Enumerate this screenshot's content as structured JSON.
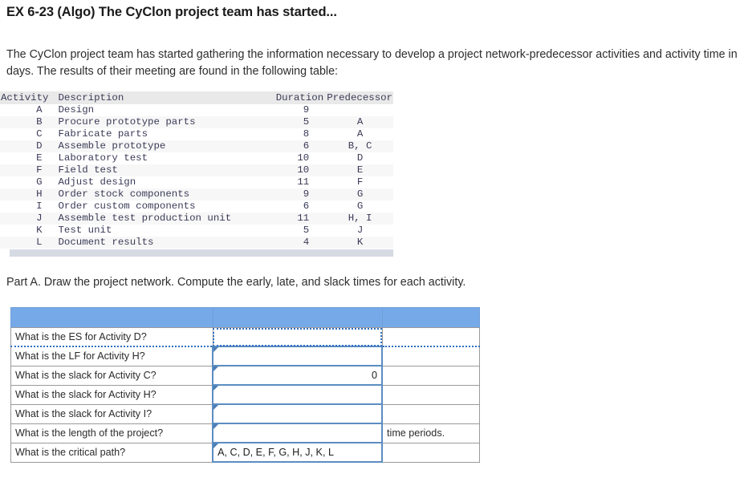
{
  "title": "EX 6-23 (Algo) The CyClon project team has started...",
  "intro": "The CyClon project team has started gathering the information necessary to develop a project network-predecessor activities and activity time in days. The results of their meeting are found in the following table:",
  "part_a": "Part A. Draw the project network. Compute the early, late, and slack times for each activity.",
  "activity_table": {
    "headers": {
      "activity": "Activity",
      "description": "Description",
      "duration": "Duration",
      "predecessor": "Predecessor"
    },
    "rows": [
      {
        "activity": "A",
        "description": "Design",
        "duration": "9",
        "predecessor": ""
      },
      {
        "activity": "B",
        "description": "Procure prototype parts",
        "duration": "5",
        "predecessor": "A"
      },
      {
        "activity": "C",
        "description": "Fabricate parts",
        "duration": "8",
        "predecessor": "A"
      },
      {
        "activity": "D",
        "description": "Assemble prototype",
        "duration": "6",
        "predecessor": "B, C"
      },
      {
        "activity": "E",
        "description": "Laboratory test",
        "duration": "10",
        "predecessor": "D"
      },
      {
        "activity": "F",
        "description": "Field test",
        "duration": "10",
        "predecessor": "E"
      },
      {
        "activity": "G",
        "description": "Adjust design",
        "duration": "11",
        "predecessor": "F"
      },
      {
        "activity": "H",
        "description": "Order stock components",
        "duration": "9",
        "predecessor": "G"
      },
      {
        "activity": "I",
        "description": "Order custom components",
        "duration": "6",
        "predecessor": "G"
      },
      {
        "activity": "J",
        "description": "Assemble test production unit",
        "duration": "11",
        "predecessor": "H, I"
      },
      {
        "activity": "K",
        "description": "Test unit",
        "duration": "5",
        "predecessor": "J"
      },
      {
        "activity": "L",
        "description": "Document results",
        "duration": "4",
        "predecessor": "K"
      }
    ]
  },
  "answer_table": {
    "header_label": "",
    "rows": [
      {
        "question": "What is the ES for Activity D?",
        "answer": "",
        "unit": ""
      },
      {
        "question": "What is the LF for Activity H?",
        "answer": "",
        "unit": ""
      },
      {
        "question": "What is the slack for Activity C?",
        "answer": "0",
        "unit": ""
      },
      {
        "question": "What is the slack for Activity H?",
        "answer": "",
        "unit": ""
      },
      {
        "question": "What is the slack for Activity I?",
        "answer": "",
        "unit": ""
      },
      {
        "question": "What is the length of the project?",
        "answer": "",
        "unit": "time periods."
      },
      {
        "question": "What is the critical path?",
        "answer": "A, C, D, E, F, G, H, J, K, L",
        "unit": ""
      }
    ]
  },
  "colors": {
    "answer_header_blue": "#76a9e8",
    "input_border_blue": "#5b8dc1",
    "selection_blue": "#2f6fc0",
    "data_header_gray": "#e9e9e9",
    "footer_bar": "#d5dae3"
  }
}
